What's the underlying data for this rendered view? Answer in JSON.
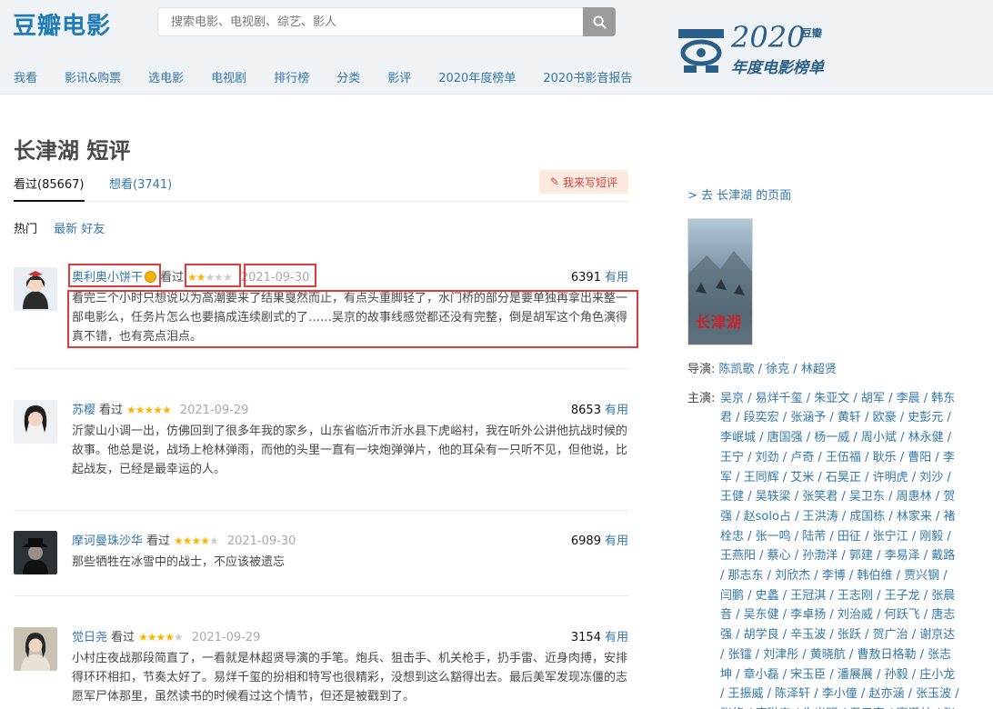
{
  "header": {
    "logo": "豆瓣电影",
    "search_placeholder": "搜索电影、电视剧、综艺、影人",
    "nav": [
      "我看",
      "影讯&购票",
      "选电影",
      "电视剧",
      "排行榜",
      "分类",
      "影评",
      "2020年度榜单",
      "2020书影音报告"
    ],
    "badge_year": "2020",
    "badge_brand": "豆瓣",
    "badge_sub": "年度电影榜单"
  },
  "page": {
    "title": "长津湖 短评",
    "tab_watched": "看过(85667)",
    "tab_want": "想看(3741)",
    "write_button": "我来写短评",
    "sorts": [
      "热门",
      "最新",
      "好友"
    ]
  },
  "comments": [
    {
      "user": "奥利奥小饼干",
      "status": "看过",
      "stars": 2,
      "date": "2021-09-30",
      "votes": "6391",
      "useful": "有用",
      "text": "看完三个小时只想说以为高潮要来了结果戛然而止，有点头重脚轻了，水门桥的部分是要单独再拿出来整一部电影么，任务片怎么也要搞成连续剧式的了……吴京的故事线感觉都还没有完整，倒是胡军这个角色演得真不错，也有亮点泪点。"
    },
    {
      "user": "苏樱",
      "status": "看过",
      "stars": 5,
      "date": "2021-09-29",
      "votes": "8653",
      "useful": "有用",
      "text": "沂蒙山小调一出，仿佛回到了很多年我的家乡，山东省临沂市沂水县下虎峪村，我在听外公讲他抗战时候的故事。他总是说，战场上枪林弹雨，而他的头里一直有一块炮弹弹片，他的耳朵有一只听不见，但他说，比起战友，已经是最幸运的人。"
    },
    {
      "user": "摩诃曼珠沙华",
      "status": "看过",
      "stars": 4,
      "date": "2021-09-30",
      "votes": "6989",
      "useful": "有用",
      "text": "那些牺牲在冰雪中的战士，不应该被遗忘"
    },
    {
      "user": "觉日尧",
      "status": "看过",
      "stars": 4,
      "date": "2021-09-29",
      "votes": "3154",
      "useful": "有用",
      "text": "小村庄夜战那段简直了，一看就是林超贤导演的手笔。炮兵、狙击手、机关枪手，扔手雷、近身肉搏，安排得环环相扣，节奏太好了。易烊千玺的扮相和特写也很精彩，没想到这么豁得出去。最后美军发现冻僵的志愿军尸体那里，虽然读书的时候看过这个情节，但还是被戳到了。"
    }
  ],
  "sidebar": {
    "goto": "> 去 长津湖 的页面",
    "poster_title": "长津湖",
    "director_label": "导演:",
    "directors": "陈凯歌 / 徐克 / 林超贤",
    "cast_label": "主演:",
    "cast": "吴京 / 易烊千玺 / 朱亚文 / 胡军 / 李晨 / 韩东君 / 段奕宏 / 张涵予 / 黄轩 / 欧豪 / 史彭元 / 李岷城 / 唐国强 / 杨一威 / 周小斌 / 林永健 / 王宁 / 刘劲 / 卢奇 / 王伍福 / 耿乐 / 曹阳 / 李军 / 王同辉 / 艾米 / 石昊正 / 许明虎 / 刘沙 / 王健 / 吴轶梁 / 张笑君 / 吴卫东 / 周惠林 / 贺强 / 赵solo占 / 王洪涛 / 成国栋 / 林家来 / 褚栓忠 / 张一鸣 / 陆芾 / 田征 / 张宁江 / 刚毅 / 王燕阳 / 蔡心 / 孙渤洋 / 郭建 / 李易泽 / 戴路 / 那志东 / 刘欣杰 / 李博 / 韩伯维 / 贾兴钢 / 闫鹏 / 史蠡 / 王冠淇 / 王志刚 / 王子龙 / 张晨音 / 吴东健 / 李卓扬 / 刘治威 / 何跃飞 / 唐志强 / 胡学良 / 辛玉波 / 张跃 / 贺广治 / 谢京达 / 张镭 / 刘津彤 / 黄晓航 / 曹敖日格勒 / 张志坤 / 章小磊 / 宋玉臣 / 潘展展 / 孙毅 / 庄小龙 / 王振威 / 陈泽轩 / 李小僮 / 赵亦涵 / 张玉波 / 张修 / 唐琳森 / 朱光明 / 尹元宣 / 骞潇林 / 张志勤 / 程亦 / 杨灿"
  }
}
